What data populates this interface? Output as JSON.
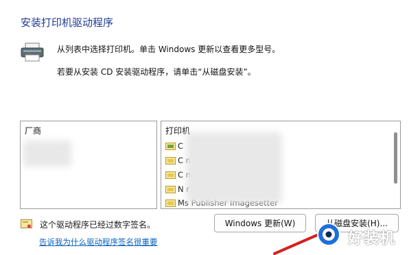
{
  "title": "安装打印机驱动程序",
  "description": {
    "line1": "从列表中选择打印机。单击 Windows 更新以查看更多型号。",
    "line2": "若要从安装 CD 安装驱动程序，请单击“从磁盘安装”。"
  },
  "manufacturer_panel": {
    "header": "厂商"
  },
  "printer_panel": {
    "header": "打印机",
    "items": [
      {
        "label": "C"
      },
      {
        "label": "C                        n"
      },
      {
        "label": "C                        n wide"
      },
      {
        "label": "N                        r"
      },
      {
        "label": "Ms Publisher Imagesetter"
      }
    ]
  },
  "signature": {
    "text": "这个驱动程序已经过数字签名。"
  },
  "link": {
    "text": "告诉我为什么驱动程序签名很重要"
  },
  "buttons": {
    "windows_update": "Windows 更新(W)",
    "have_disk": "从磁盘安装(H)..."
  },
  "watermark": {
    "text": "好装机"
  },
  "colors": {
    "title": "#1f3a93",
    "link": "#0b63b9",
    "arrow": "#d61f1f",
    "badge": "#1e6fd9"
  },
  "icons": [
    "printer-icon",
    "driver-file-icon",
    "certificate-icon",
    "arrow-annotation",
    "watermark-badge-icon"
  ]
}
